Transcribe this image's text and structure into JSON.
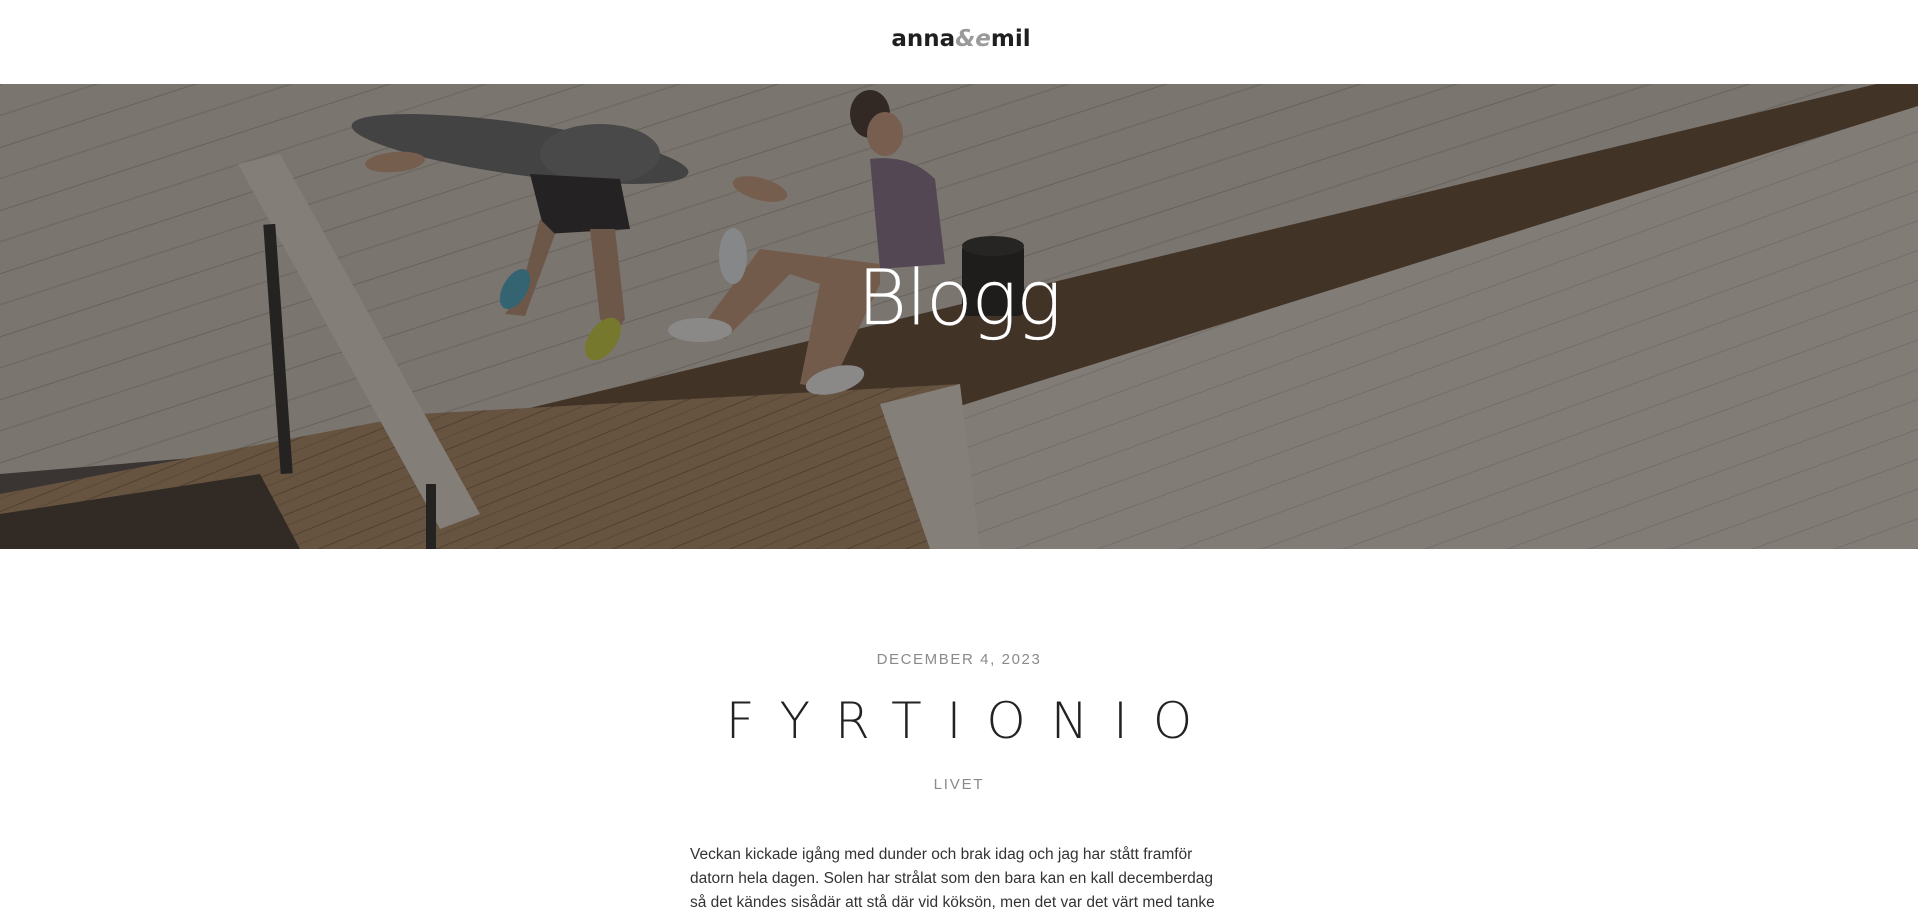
{
  "header": {
    "logo_part1": "anna",
    "logo_part2": "&e",
    "logo_part3": "mil"
  },
  "hero": {
    "title": "Blogg"
  },
  "post": {
    "date": "DECEMBER 4, 2023",
    "title": "FYRTIONIO",
    "category": "LIVET",
    "body_lines": [
      "Veckan kickade igång med dunder och brak idag och jag har stått framför",
      "datorn hela dagen. Solen har strålat som den bara kan en kall decemberdag",
      "så det kändes sisådär att stå där vid köksön, men det var det värt med tanke"
    ]
  },
  "colors": {
    "hero_overlay": "#3a3532",
    "deck_light": "#d8d2c8",
    "accent_text": "#8a8a8a"
  }
}
